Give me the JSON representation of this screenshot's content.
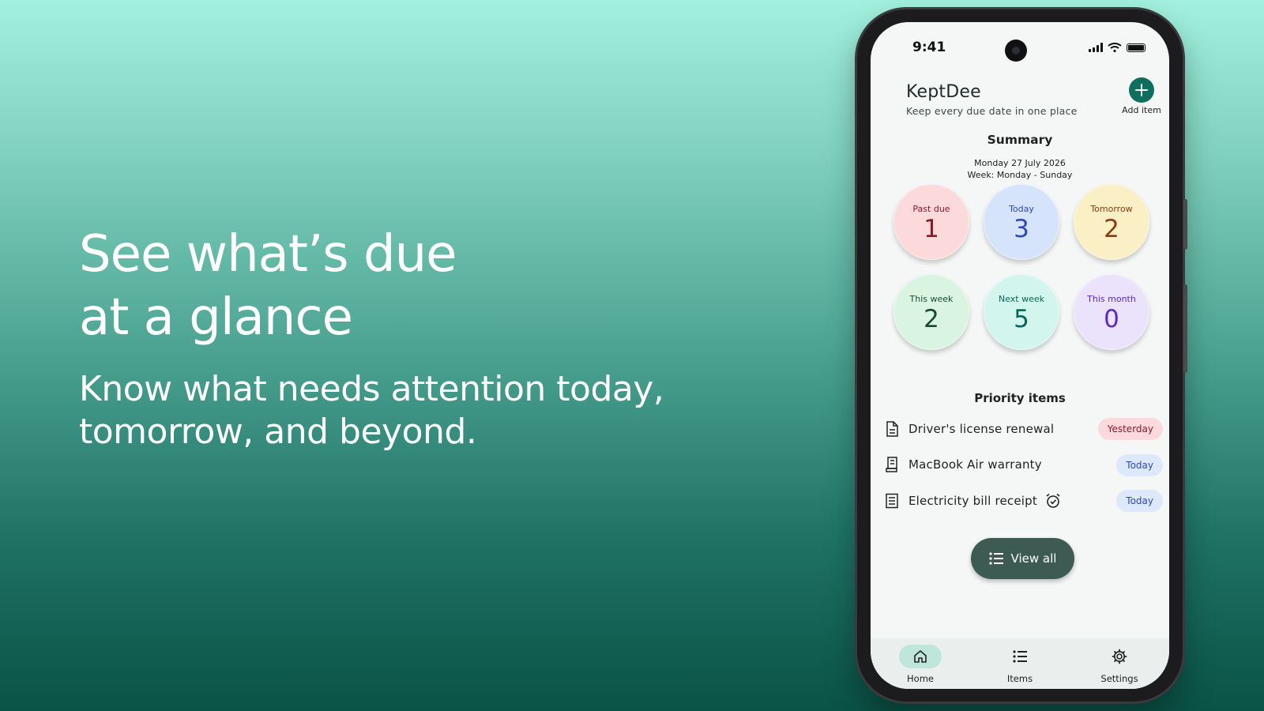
{
  "promo": {
    "headline_line1": "See what’s due",
    "headline_line2": "at a glance",
    "subtext_line1": "Know what needs attention today,",
    "subtext_line2": "tomorrow, and beyond."
  },
  "status_bar": {
    "time": "9:41"
  },
  "header": {
    "app_title": "KeptDee",
    "app_subtitle": "Keep every due date in one place",
    "add_label": "Add item"
  },
  "summary": {
    "title": "Summary",
    "date": "Monday 27 July 2026",
    "week": "Week: Monday - Sunday",
    "tiles": [
      {
        "label": "Past due",
        "count": "1",
        "bg": "#fcd9da",
        "fg": "#8a1a2a"
      },
      {
        "label": "Today",
        "count": "3",
        "bg": "#d6e4fb",
        "fg": "#2a48b8"
      },
      {
        "label": "Tomorrow",
        "count": "2",
        "bg": "#fbefc6",
        "fg": "#8a3a10"
      },
      {
        "label": "This week",
        "count": "2",
        "bg": "#d9f5e1",
        "fg": "#1a4a2a"
      },
      {
        "label": "Next week",
        "count": "5",
        "bg": "#d2f6ee",
        "fg": "#0a6656"
      },
      {
        "label": "This month",
        "count": "0",
        "bg": "#ebe3fb",
        "fg": "#5a28c8"
      }
    ]
  },
  "priority": {
    "title": "Priority items",
    "items": [
      {
        "name": "Driver's license renewal",
        "icon": "document-icon",
        "badge": "Yesterday",
        "badge_bg": "#fbd9dc",
        "badge_fg": "#8a1a2a",
        "alarm": false
      },
      {
        "name": "MacBook Air warranty",
        "icon": "receipt-icon",
        "badge": "Today",
        "badge_bg": "#dde8fb",
        "badge_fg": "#2a48b8",
        "alarm": false
      },
      {
        "name": "Electricity bill receipt",
        "icon": "bill-icon",
        "badge": "Today",
        "badge_bg": "#dde8fb",
        "badge_fg": "#2a48b8",
        "alarm": true
      }
    ]
  },
  "view_all": {
    "label": "View all"
  },
  "nav": {
    "tabs": [
      {
        "label": "Home",
        "icon": "home-icon",
        "active": true
      },
      {
        "label": "Items",
        "icon": "list-icon",
        "active": false
      },
      {
        "label": "Settings",
        "icon": "gear-icon",
        "active": false
      }
    ]
  },
  "colors": {
    "accent": "#0f6e5e",
    "button": "#3d5b53"
  }
}
